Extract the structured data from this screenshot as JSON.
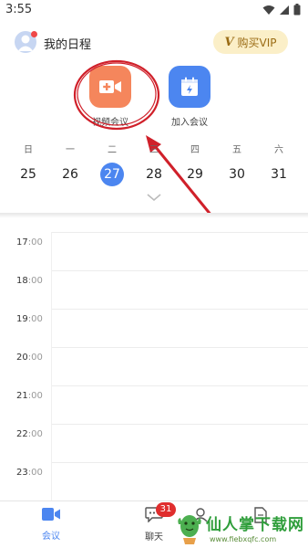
{
  "status_bar": {
    "time": "3:55"
  },
  "header": {
    "title": "我的日程",
    "vip_label": "购买VIP",
    "vip_mark": "V"
  },
  "actions": [
    {
      "label": "视频会议",
      "icon": "video-camera-plus-icon",
      "color": "#f5865c"
    },
    {
      "label": "加入会议",
      "icon": "calendar-join-icon",
      "color": "#4c86f0"
    }
  ],
  "week": {
    "weekdays": [
      "日",
      "一",
      "二",
      "三",
      "四",
      "五",
      "六"
    ],
    "dates": [
      "25",
      "26",
      "27",
      "28",
      "29",
      "30",
      "31"
    ],
    "selected_index": 2
  },
  "timeline": {
    "hours": [
      {
        "h": "17",
        "m": ":00"
      },
      {
        "h": "18",
        "m": ":00"
      },
      {
        "h": "19",
        "m": ":00"
      },
      {
        "h": "20",
        "m": ":00"
      },
      {
        "h": "21",
        "m": ":00"
      },
      {
        "h": "22",
        "m": ":00"
      },
      {
        "h": "23",
        "m": ":00"
      }
    ]
  },
  "tabbar": {
    "tabs": [
      {
        "label": "会议",
        "icon": "video-camera-icon",
        "active": true
      },
      {
        "label": "聊天",
        "icon": "chat-bubble-icon",
        "active": false,
        "badge": "31"
      },
      {
        "label": "",
        "icon": "contacts-icon",
        "active": false
      },
      {
        "label": "",
        "icon": "document-icon",
        "active": false
      }
    ]
  },
  "watermark": {
    "title": "仙人掌下载网",
    "url": "www.fiebxqfc.com"
  },
  "colors": {
    "accent": "#4c86f0",
    "video": "#f5865c",
    "badge": "#e02e2e",
    "annotation": "#d0202a"
  }
}
